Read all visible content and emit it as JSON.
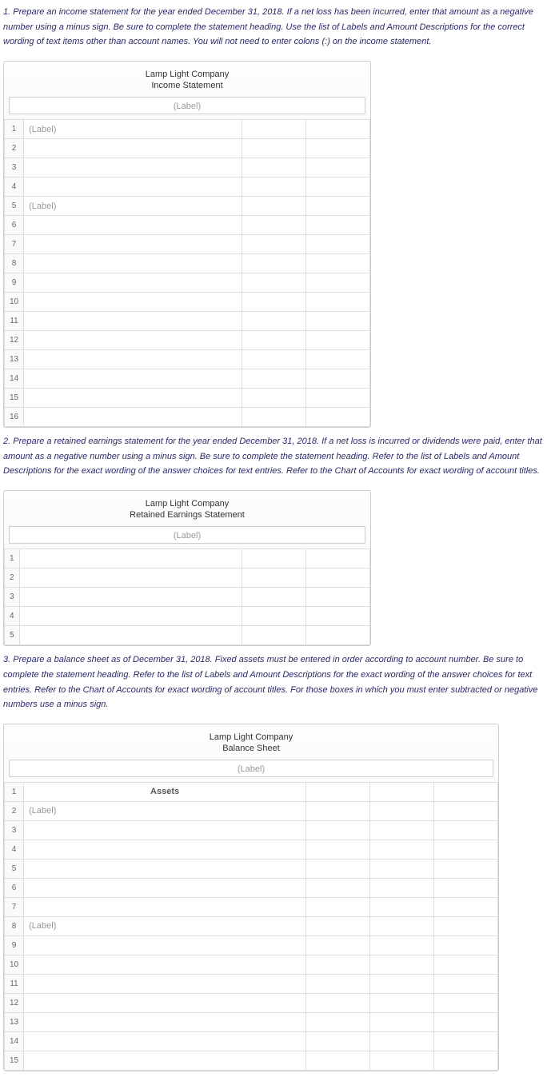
{
  "q1": {
    "instruction": "1. Prepare an income statement for the year ended December 31, 2018. If a net loss has been incurred, enter that amount as a negative number using a minus sign. Be sure to complete the statement heading. Use the list of Labels and Amount Descriptions for the correct wording of text items other than account names. You will not need to enter colons (:) on the income statement.",
    "company": "Lamp Light Company",
    "title": "Income Statement",
    "label_placeholder": "(Label)",
    "rows": [
      {
        "n": "1",
        "desc": "(Label)"
      },
      {
        "n": "2",
        "desc": ""
      },
      {
        "n": "3",
        "desc": ""
      },
      {
        "n": "4",
        "desc": ""
      },
      {
        "n": "5",
        "desc": "(Label)"
      },
      {
        "n": "6",
        "desc": ""
      },
      {
        "n": "7",
        "desc": ""
      },
      {
        "n": "8",
        "desc": ""
      },
      {
        "n": "9",
        "desc": ""
      },
      {
        "n": "10",
        "desc": ""
      },
      {
        "n": "11",
        "desc": ""
      },
      {
        "n": "12",
        "desc": ""
      },
      {
        "n": "13",
        "desc": ""
      },
      {
        "n": "14",
        "desc": ""
      },
      {
        "n": "15",
        "desc": ""
      },
      {
        "n": "16",
        "desc": ""
      }
    ]
  },
  "q2": {
    "instruction": "2. Prepare a retained earnings statement for the year ended December 31, 2018. If a net loss is incurred or dividends were paid, enter that amount as a negative number using a minus sign. Be sure to complete the statement heading. Refer to the list of Labels and Amount Descriptions for the exact wording of the answer choices for text entries. Refer to the Chart of Accounts for exact wording of account titles.",
    "company": "Lamp Light Company",
    "title": "Retained Earnings Statement",
    "label_placeholder": "(Label)",
    "rows": [
      {
        "n": "1",
        "desc": ""
      },
      {
        "n": "2",
        "desc": ""
      },
      {
        "n": "3",
        "desc": ""
      },
      {
        "n": "4",
        "desc": ""
      },
      {
        "n": "5",
        "desc": ""
      }
    ]
  },
  "q3": {
    "instruction": "3. Prepare a balance sheet as of December 31, 2018. Fixed assets must be entered in order according to account number. Be sure to complete the statement heading. Refer to the list of Labels and Amount Descriptions for the exact wording of the answer choices for text entries. Refer to the Chart of Accounts for exact wording of account titles. For those boxes in which you must enter subtracted or negative numbers use a minus sign.",
    "company": "Lamp Light Company",
    "title": "Balance Sheet",
    "label_placeholder": "(Label)",
    "section1": "Assets",
    "rows": [
      {
        "n": "1",
        "desc": "",
        "section": "Assets"
      },
      {
        "n": "2",
        "desc": "(Label)"
      },
      {
        "n": "3",
        "desc": ""
      },
      {
        "n": "4",
        "desc": ""
      },
      {
        "n": "5",
        "desc": ""
      },
      {
        "n": "6",
        "desc": ""
      },
      {
        "n": "7",
        "desc": ""
      },
      {
        "n": "8",
        "desc": "(Label)"
      },
      {
        "n": "9",
        "desc": ""
      },
      {
        "n": "10",
        "desc": ""
      },
      {
        "n": "11",
        "desc": ""
      },
      {
        "n": "12",
        "desc": ""
      },
      {
        "n": "13",
        "desc": ""
      },
      {
        "n": "14",
        "desc": ""
      },
      {
        "n": "15",
        "desc": ""
      }
    ]
  }
}
